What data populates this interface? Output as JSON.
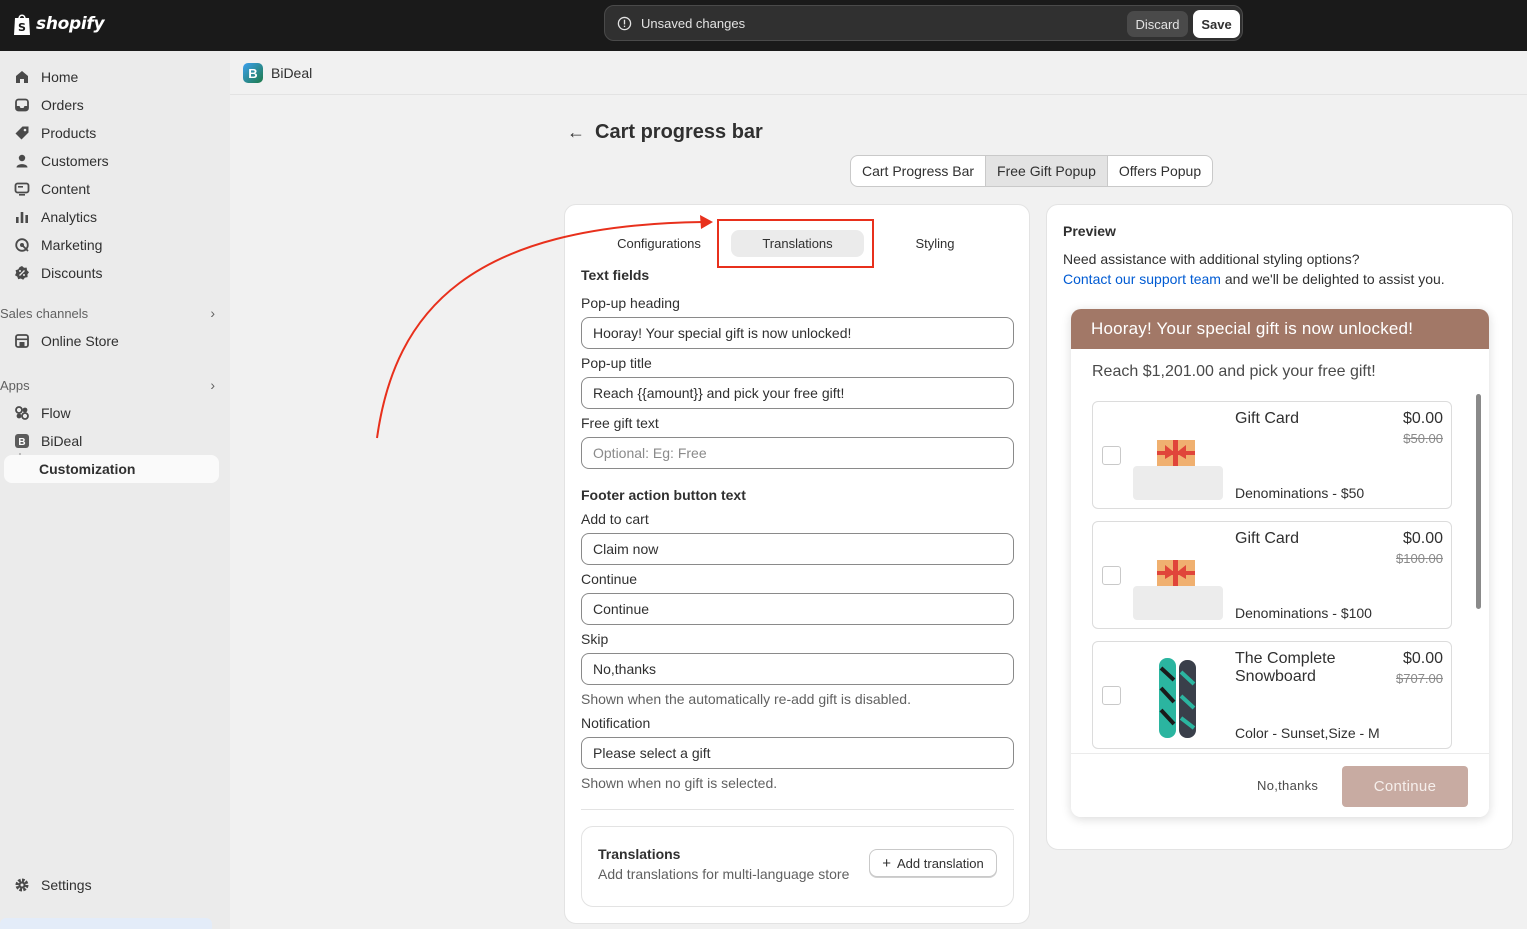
{
  "topbar": {
    "brand": "shopify",
    "unsaved_text": "Unsaved changes",
    "discard_label": "Discard",
    "save_label": "Save"
  },
  "sidebar": {
    "items": [
      {
        "label": "Home",
        "icon": "home-icon"
      },
      {
        "label": "Orders",
        "icon": "inbox-icon"
      },
      {
        "label": "Products",
        "icon": "tag-icon"
      },
      {
        "label": "Customers",
        "icon": "person-icon"
      },
      {
        "label": "Content",
        "icon": "content-icon"
      },
      {
        "label": "Analytics",
        "icon": "bar-chart-icon"
      },
      {
        "label": "Marketing",
        "icon": "target-icon"
      },
      {
        "label": "Discounts",
        "icon": "discount-icon"
      }
    ],
    "sales_channels_label": "Sales channels",
    "online_store_label": "Online Store",
    "apps_label": "Apps",
    "flow_label": "Flow",
    "bideal_label": "BiDeal",
    "customization_label": "Customization",
    "settings_label": "Settings"
  },
  "app": {
    "icon_letter": "B",
    "name": "BiDeal"
  },
  "page": {
    "title": "Cart progress bar",
    "back_glyph": "←"
  },
  "segments": {
    "items": [
      "Cart Progress Bar",
      "Free Gift Popup",
      "Offers Popup"
    ],
    "selected": "Free Gift Popup"
  },
  "form": {
    "tabs": [
      "Configurations",
      "Translations",
      "Styling"
    ],
    "selected_tab": "Translations",
    "text_fields_heading": "Text fields",
    "popup_heading_label": "Pop-up heading",
    "popup_heading_value": "Hooray! Your special gift is now unlocked!",
    "popup_title_label": "Pop-up title",
    "popup_title_value": "Reach {{amount}} and pick your free gift!",
    "free_gift_label": "Free gift text",
    "free_gift_placeholder": "Optional:  Eg: Free",
    "footer_heading": "Footer action button text",
    "add_to_cart_label": "Add to cart",
    "add_to_cart_value": "Claim now",
    "continue_label": "Continue",
    "continue_value": "Continue",
    "skip_label": "Skip",
    "skip_value": "No,thanks",
    "skip_help": "Shown when the automatically re-add gift is disabled.",
    "notification_label": "Notification",
    "notification_value": "Please select a gift",
    "notification_help": "Shown when no gift is selected.",
    "translations_title": "Translations",
    "translations_desc": "Add translations for multi-language store",
    "add_translation_label": "Add translation"
  },
  "preview": {
    "title": "Preview",
    "help_line1": "Need assistance with additional styling options?",
    "help_link": "Contact our support team",
    "help_line2_rest": " and we'll be delighted to assist you.",
    "popup_heading": "Hooray! Your special gift is now unlocked!",
    "popup_subtitle": "Reach $1,201.00 and pick your free gift!",
    "gifts": [
      {
        "name": "Gift Card",
        "price": "$0.00",
        "old_price": "$50.00",
        "variant": "Denominations - $50"
      },
      {
        "name": "Gift Card",
        "price": "$0.00",
        "old_price": "$100.00",
        "variant": "Denominations - $100"
      },
      {
        "name": "The Complete Snowboard",
        "price": "$0.00",
        "old_price": "$707.00",
        "variant": "Color - Sunset,Size - M"
      }
    ],
    "no_thanks_label": "No,thanks",
    "continue_label": "Continue",
    "header_color": "#a27867",
    "continue_color": "#c8aba2"
  },
  "annotation": {
    "highlight_color": "#e8301c"
  }
}
